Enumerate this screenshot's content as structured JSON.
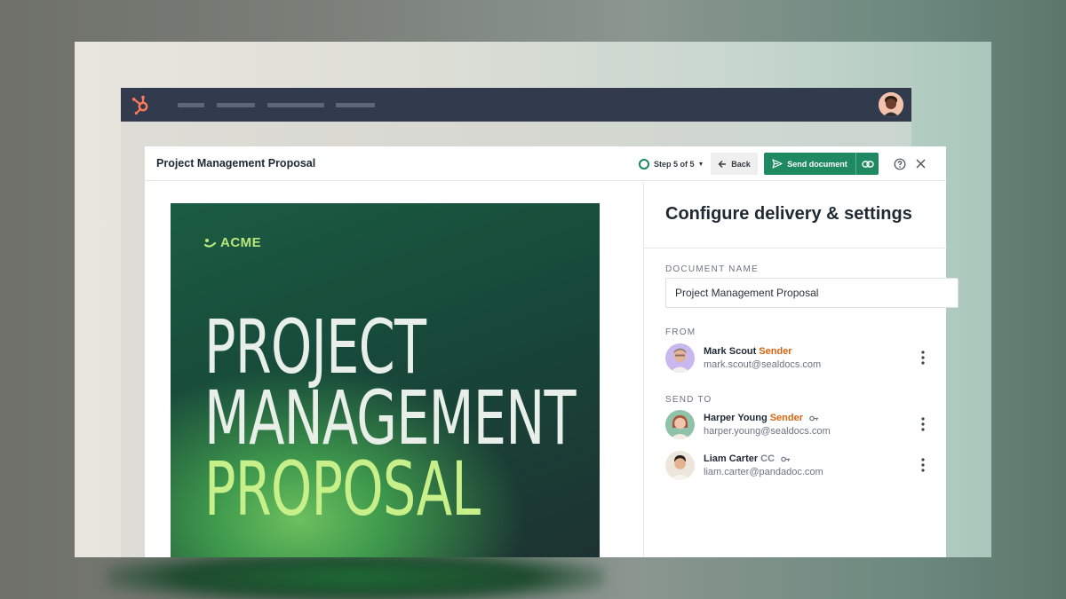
{
  "topbar": {
    "logo_icon": "hubspot-sprocket-icon",
    "nav_placeholders": 4,
    "avatar_icon": "user-avatar-icon"
  },
  "modal": {
    "title": "Project Management Proposal",
    "step_label": "Step 5 of 5",
    "back_label": "Back",
    "send_label": "Send document",
    "accent_color": "#1f8a62"
  },
  "preview": {
    "brand": "ACME",
    "cover_lines": [
      "PROJECT",
      "MANAGEMENT",
      "PROPOSAL"
    ]
  },
  "settings": {
    "title": "Configure delivery & settings",
    "document_name_label": "DOCUMENT NAME",
    "document_name_value": "Project Management Proposal",
    "from_label": "FROM",
    "send_to_label": "SEND TO",
    "from": {
      "name": "Mark Scout",
      "role": "Sender",
      "email": "mark.scout@sealdocs.com"
    },
    "recipients": [
      {
        "name": "Harper Young",
        "role": "Sender",
        "email": "harper.young@sealdocs.com"
      },
      {
        "name": "Liam Carter",
        "role": "CC",
        "email": "liam.carter@pandadoc.com"
      }
    ],
    "role_colors": {
      "Sender": "#d9630f",
      "CC": "#7a828a"
    }
  }
}
